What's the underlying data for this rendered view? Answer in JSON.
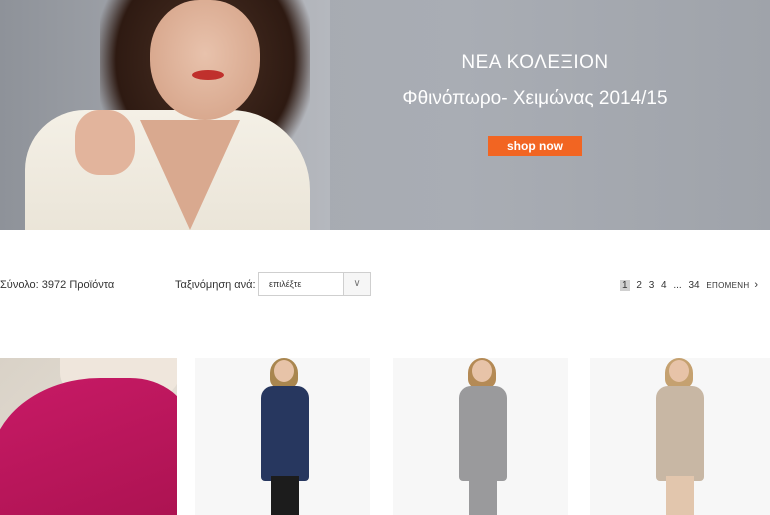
{
  "banner": {
    "title": "ΝΕΑ ΚΟΛΕΞΙΟΝ",
    "subtitle": "Φθινόπωρο- Χειμώνας 2014/15",
    "cta_label": "shop now",
    "cta_color": "#f26522"
  },
  "toolbar": {
    "total_text": "Σύνολο: 3972 Προϊόντα",
    "sort_label": "Ταξινόμηση ανά:",
    "sort_value": "επιλέξτε",
    "sort_arrow_icon": "chevron-down-icon"
  },
  "pagination": {
    "pages": [
      "1",
      "2",
      "3",
      "4"
    ],
    "ellipsis": "...",
    "last_page": "34",
    "next_label": "ΕΠΟΜΕΝΗ",
    "current_page": "1"
  },
  "products": [
    {
      "color": "#c81a66"
    },
    {
      "color": "#27375f"
    },
    {
      "color": "#9a9a9c"
    },
    {
      "color": "#c8b7a4"
    }
  ]
}
